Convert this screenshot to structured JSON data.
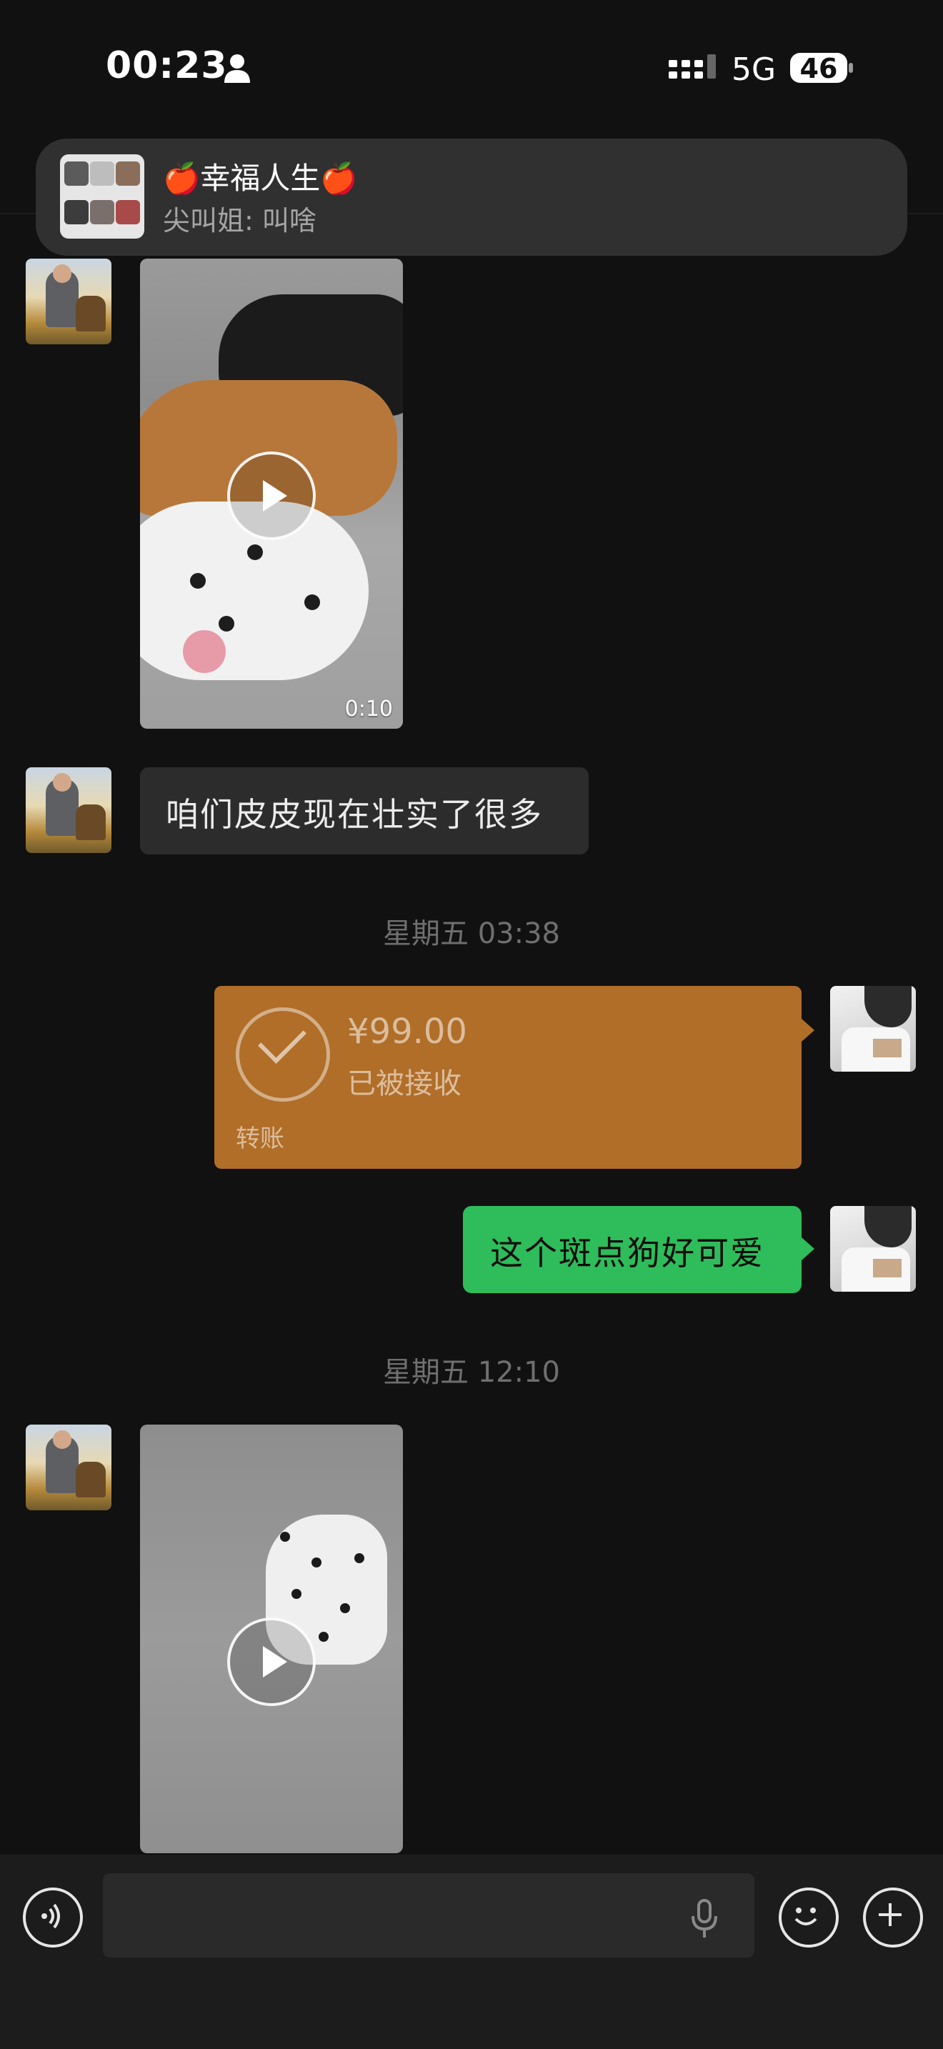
{
  "status_bar": {
    "time": "00:23",
    "network": "5G",
    "battery": "46",
    "icons": [
      "person-icon",
      "signal-icon",
      "battery-icon"
    ]
  },
  "notification": {
    "title": "🍎幸福人生🍎",
    "message": "尖叫姐: 叫啥"
  },
  "messages": {
    "video1": {
      "duration": "0:10"
    },
    "text_received": "咱们皮皮现在壮实了很多",
    "timestamp1": "星期五 03:38",
    "transfer": {
      "amount": "¥99.00",
      "status": "已被接收",
      "label": "转账"
    },
    "text_sent": "这个斑点狗好可爱",
    "timestamp2": "星期五 12:10"
  },
  "input_bar": {
    "icons": [
      "voice-icon",
      "mic-icon",
      "emoji-icon",
      "plus-icon"
    ]
  },
  "colors": {
    "background": "#111111",
    "bubble_received": "#2c2c2c",
    "bubble_sent": "#2ebd5a",
    "transfer": "#b06e28",
    "notification": "#303030"
  }
}
